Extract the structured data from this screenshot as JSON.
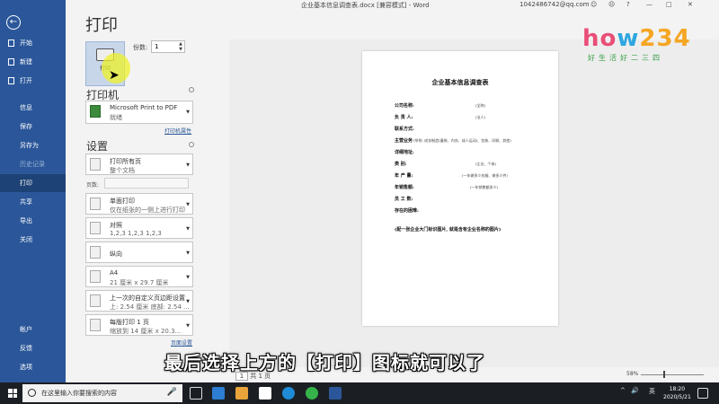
{
  "window": {
    "doc_title": "企业基本信息调查表.docx [兼容模式] - Word",
    "user": "1042486742@qq.com",
    "controls": [
      "☺",
      "☹",
      "?",
      "—",
      "□",
      "✕"
    ]
  },
  "sidebar": {
    "back": "←",
    "items": [
      {
        "label": "开始"
      },
      {
        "label": "新建"
      },
      {
        "label": "打开"
      },
      {
        "label": "信息"
      },
      {
        "label": "保存"
      },
      {
        "label": "另存为"
      },
      {
        "label": "历史记录"
      },
      {
        "label": "打印"
      },
      {
        "label": "共享"
      },
      {
        "label": "导出"
      },
      {
        "label": "关闭"
      },
      {
        "label": "帐户"
      },
      {
        "label": "反馈"
      },
      {
        "label": "选项"
      }
    ]
  },
  "print": {
    "page_title": "打印",
    "button_label": "打印",
    "copies_label": "份数:",
    "copies_value": "1",
    "printer_heading": "打印机",
    "printer_name": "Microsoft Print to PDF",
    "printer_status": "就绪",
    "printer_props": "打印机属性",
    "settings_heading": "设置",
    "options": [
      {
        "line1": "打印所有页",
        "line2": "整个文档"
      },
      {
        "line1": "单面打印",
        "line2": "仅在纸张的一侧上进行打印"
      },
      {
        "line1": "对照",
        "line2": "1,2,3    1,2,3    1,2,3"
      },
      {
        "line1": "纵向",
        "line2": ""
      },
      {
        "line1": "A4",
        "line2": "21 厘米 x 29.7 厘米"
      },
      {
        "line1": "上一次的自定义页边距设置",
        "line2": "上: 2.54 厘米 底部: 2.54 ..."
      },
      {
        "line1": "每版打印 1 页",
        "line2": "缩放到 14 厘米 x 20.3..."
      }
    ],
    "pages_label": "页数:",
    "page_setup": "页面设置"
  },
  "document": {
    "title": "企业基本信息调查表",
    "rows": [
      {
        "label": "公司名称:",
        "note": "(全称)"
      },
      {
        "label": "负 责 人:",
        "note": "(法人)"
      },
      {
        "label": "联系方式:",
        "note": ""
      },
      {
        "label": "主营业务",
        "note": "(举例: 成衣制造(童装、内衣、成人运动)、包装、印刷、其他)"
      },
      {
        "label": "详细地址:",
        "note": ""
      },
      {
        "label": "类    别:",
        "note": "(企业、个体)"
      },
      {
        "label": "年 产 量:",
        "note": "(一年做多少衣服、做多少件)"
      },
      {
        "label": "年销售额:",
        "note": "(一年销售额多少)"
      },
      {
        "label": "员 工 数:",
        "note": ""
      },
      {
        "label": "存在的困难:",
        "note": ""
      }
    ],
    "footer": "(配一张企业大门标识图片, 就是含有企业名称的图片)"
  },
  "logo": {
    "text_a": "ho",
    "text_b": "w",
    "text_c": "234",
    "slogan": "好生活好二三四"
  },
  "caption": "最后选择上方的【打印】图标就可以了",
  "status": {
    "page_of": "共 1 页",
    "page_current": "1",
    "zoom": "58%"
  },
  "taskbar": {
    "search_placeholder": "在这里输入你要搜索的内容",
    "time": "18:20",
    "date": "2020/5/21",
    "lang": "英"
  }
}
